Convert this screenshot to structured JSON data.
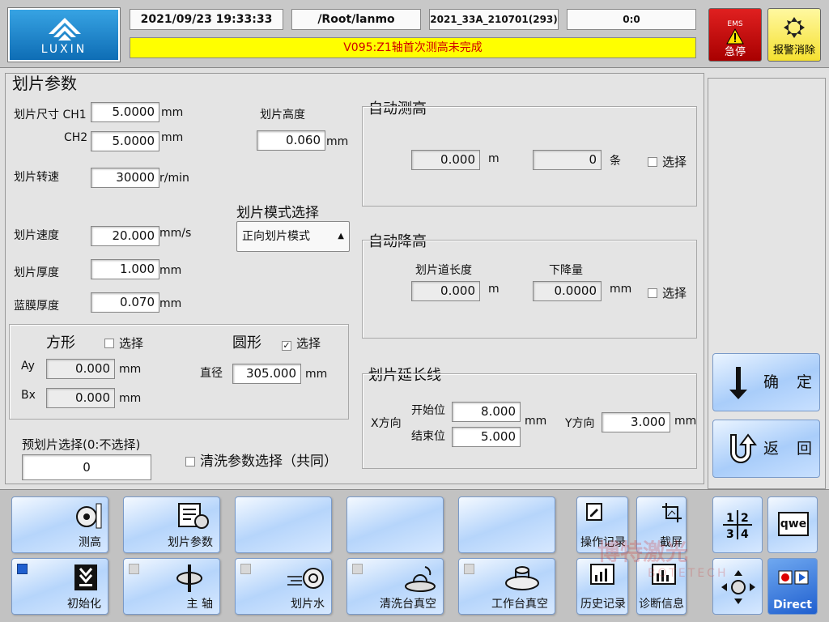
{
  "header": {
    "logo_text": "LUXIN",
    "datetime": "2021/09/23 19:33:33",
    "path": "/Root/lanmo",
    "recipe": "2021_33A_210701(293)",
    "counter": "0:0",
    "alarm_message": "V095:Z1轴首次测高未完成",
    "ems_tag": "EMS",
    "ems_label": "急停",
    "alarm_clear_label": "报警消除"
  },
  "dicing": {
    "section_title": "划片参数",
    "size_label": "划片尺寸 CH1",
    "ch1_value": "5.0000",
    "ch2_label": "CH2",
    "ch2_value": "5.0000",
    "height_label": "划片高度",
    "height_value": "0.060",
    "spindle_label": "划片转速",
    "spindle_value": "30000",
    "spindle_unit": "r/min",
    "mode_label": "划片模式选择",
    "mode_value": "正向划片模式",
    "speed_label": "划片速度",
    "speed_value": "20.000",
    "speed_unit": "mm/s",
    "thickness_label": "划片厚度",
    "thickness_value": "1.000",
    "tape_label": "蓝膜厚度",
    "tape_value": "0.070",
    "unit_mm": "mm"
  },
  "shape": {
    "square_title": "方形",
    "square_check": "选择",
    "ay_label": "Ay",
    "ay_value": "0.000",
    "bx_label": "Bx",
    "bx_value": "0.000",
    "circle_title": "圆形",
    "circle_check": "选择",
    "diameter_label": "直径",
    "diameter_value": "305.000"
  },
  "pre_dice": {
    "label": "预划片选择(0:不选择)",
    "value": "0",
    "clean_label": "清洗参数选择（共同）"
  },
  "auto_measure": {
    "title": "自动测高",
    "value1": "0.000",
    "unit1": "m",
    "value2": "0",
    "unit2": "条",
    "check": "选择"
  },
  "auto_lower": {
    "title": "自动降高",
    "len_label": "划片道长度",
    "len_value": "0.000",
    "len_unit": "m",
    "drop_label": "下降量",
    "drop_value": "0.0000",
    "drop_unit": "mm",
    "check": "选择"
  },
  "extension": {
    "title": "划片延长线",
    "x_label": "X方向",
    "start_label": "开始位",
    "start_value": "8.000",
    "end_label": "结束位",
    "end_value": "5.000",
    "y_label": "Y方向",
    "y_value": "3.000",
    "unit": "mm"
  },
  "actions": {
    "confirm": "确 定",
    "back": "返 回"
  },
  "toolbar": {
    "measure": "测高",
    "dicing_params": "划片参数",
    "op_log": "操作记录",
    "screenshot": "截屏",
    "init": "初始化",
    "spindle": "主 轴",
    "dicing_water": "划片水",
    "clean_vacuum": "清洗台真空",
    "table_vacuum": "工作台真空",
    "history": "历史记录",
    "diagnosis": "诊断信息",
    "keyboard": "qwe",
    "direct": "Direct"
  },
  "watermark": {
    "cn": "博特激光",
    "en": "BOTETECH"
  }
}
